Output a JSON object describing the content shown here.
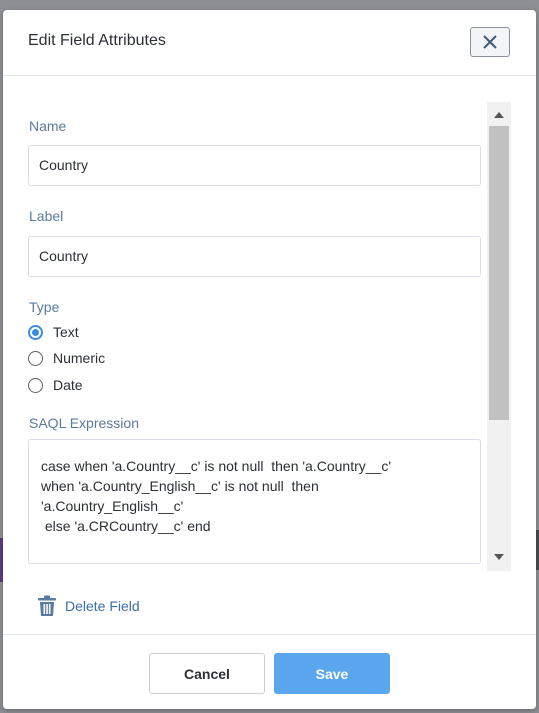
{
  "dialog": {
    "title": "Edit Field Attributes",
    "close_icon": "close-icon"
  },
  "form": {
    "name_label": "Name",
    "name_value": "Country",
    "label_label": "Label",
    "label_value": "Country",
    "type_label": "Type",
    "type_options": [
      {
        "label": "Text",
        "selected": true
      },
      {
        "label": "Numeric",
        "selected": false
      },
      {
        "label": "Date",
        "selected": false
      }
    ],
    "saql_label": "SAQL Expression",
    "saql_value": "case when 'a.Country__c' is not null  then 'a.Country__c'\nwhen 'a.Country_English__c' is not null  then\n'a.Country_English__c'\n else 'a.CRCountry__c' end"
  },
  "actions": {
    "delete_label": "Delete Field",
    "delete_icon": "trash-icon",
    "cancel_label": "Cancel",
    "save_label": "Save"
  },
  "colors": {
    "accent": "#3d8be8",
    "save_button": "#5aa7f0",
    "field_label": "#5a7aa0",
    "link": "#3d6fa8"
  }
}
